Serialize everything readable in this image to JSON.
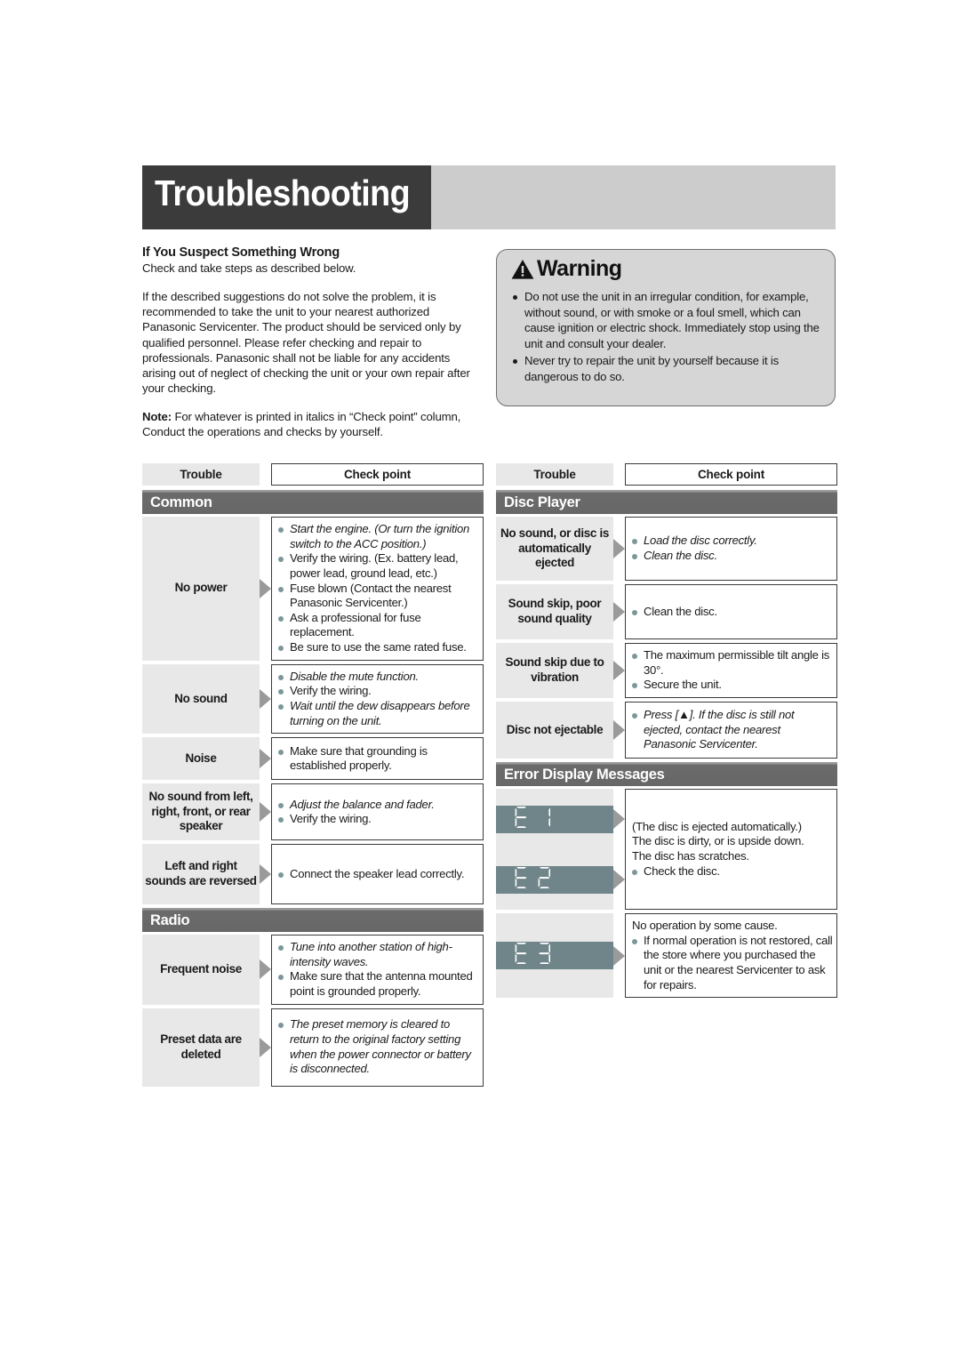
{
  "header": {
    "title": "Troubleshooting"
  },
  "intro": {
    "heading": "If You Suspect Something Wrong",
    "subheading": "Check and take steps as described below.",
    "body": "If the described suggestions do not solve the problem, it is recommended to take the unit to your nearest authorized Panasonic Servicenter. The product should be serviced only by qualified personnel. Please refer checking and repair to professionals. Panasonic shall not be liable for any accidents arising out of neglect of checking the unit or your own repair after your checking.",
    "note_label": "Note:",
    "note_text": " For whatever is printed in italics in “Check point” column, Conduct the operations and checks by yourself."
  },
  "warning": {
    "title": "Warning",
    "icon": "warning-triangle-icon",
    "items": [
      "Do not use the unit in an irregular condition, for example, without sound, or with smoke or a foul smell, which can cause ignition or electric shock. Immediately stop using the unit and consult your dealer.",
      "Never try to repair the unit by yourself because it is dangerous to do so."
    ]
  },
  "table_headers": {
    "trouble": "Trouble",
    "check_point": "Check point"
  },
  "left_column": {
    "sections": [
      {
        "title": "Common",
        "rows": [
          {
            "trouble": "No power",
            "checks": [
              {
                "text": "Start the engine. (Or turn the ignition switch to the ACC position.)",
                "italic": true
              },
              {
                "text": "Verify the wiring. (Ex. battery lead, power lead, ground lead, etc.)",
                "italic": false
              },
              {
                "text": "Fuse blown (Contact the nearest Panasonic Servicenter.)",
                "italic": false
              },
              {
                "text": "Ask a professional for fuse replacement.",
                "italic": false
              },
              {
                "text": "Be sure to use the same rated fuse.",
                "italic": false
              }
            ]
          },
          {
            "trouble": "No sound",
            "checks": [
              {
                "text": "Disable the mute function.",
                "italic": true
              },
              {
                "text": "Verify the wiring.",
                "italic": false
              },
              {
                "text": "Wait until the dew disappears before turning on the unit.",
                "italic": true
              }
            ]
          },
          {
            "trouble": "Noise",
            "checks": [
              {
                "text": "Make sure that grounding is established properly.",
                "italic": false
              }
            ]
          },
          {
            "trouble": "No sound from left, right, front, or rear speaker",
            "checks": [
              {
                "text": "Adjust the balance and fader.",
                "italic": true
              },
              {
                "text": "Verify the wiring.",
                "italic": false
              }
            ]
          },
          {
            "trouble": "Left and right sounds are reversed",
            "checks": [
              {
                "text": "Connect the speaker lead correctly.",
                "italic": false
              }
            ]
          }
        ]
      },
      {
        "title": "Radio",
        "rows": [
          {
            "trouble": "Frequent noise",
            "checks": [
              {
                "text": "Tune into another station of high-intensity waves.",
                "italic": true
              },
              {
                "text": "Make sure that the antenna mounted point is grounded properly.",
                "italic": false
              }
            ]
          },
          {
            "trouble": "Preset data are deleted",
            "checks": [
              {
                "text": "The preset memory is cleared to return to the original factory setting when the power connector or battery is disconnected.",
                "italic": true
              }
            ]
          }
        ]
      }
    ]
  },
  "right_column": {
    "sections": [
      {
        "title": "Disc Player",
        "rows": [
          {
            "trouble": "No sound, or disc is automatically ejected",
            "checks": [
              {
                "text": "Load the disc correctly.",
                "italic": true
              },
              {
                "text": "Clean the disc.",
                "italic": true
              }
            ]
          },
          {
            "trouble": "Sound skip, poor sound quality",
            "checks": [
              {
                "text": "Clean the disc.",
                "italic": false
              }
            ]
          },
          {
            "trouble": "Sound skip due to vibration",
            "checks": [
              {
                "text": "The maximum permissible tilt angle is 30°.",
                "italic": false
              },
              {
                "text": "Secure the unit.",
                "italic": false
              }
            ]
          },
          {
            "trouble": "Disc not ejectable",
            "checks": [
              {
                "text": "Press [▲]. If the disc is still not ejected, contact the nearest Panasonic Servicenter.",
                "italic": true
              }
            ]
          }
        ]
      }
    ],
    "error_section": {
      "title": "Error Display Messages",
      "groups": [
        {
          "codes": [
            "E1",
            "E2"
          ],
          "lines": [
            {
              "text": "(The disc is ejected automatically.)",
              "bullet": false
            },
            {
              "text": "The disc is dirty, or is upside down.",
              "bullet": false
            },
            {
              "text": "The disc has scratches.",
              "bullet": false
            },
            {
              "text": "Check the disc.",
              "bullet": true
            }
          ]
        },
        {
          "codes": [
            "E3"
          ],
          "lines": [
            {
              "text": "No operation by some cause.",
              "bullet": false
            },
            {
              "text": "If normal operation is not restored, call the store where you purchased the unit or the nearest Servicenter to ask for repairs.",
              "bullet": true
            }
          ]
        }
      ]
    }
  },
  "colors": {
    "banner_dark": "#3b3b3b",
    "banner_light": "#cccccc",
    "section_bar": "#676767",
    "trouble_cell": "#e8e8e8",
    "arrow": "#9a9a9a",
    "bullet": "#7d9699",
    "lcd_background": "#6f8589",
    "lcd_text": "#ffffff",
    "warning_box": "#d6d6d6"
  }
}
